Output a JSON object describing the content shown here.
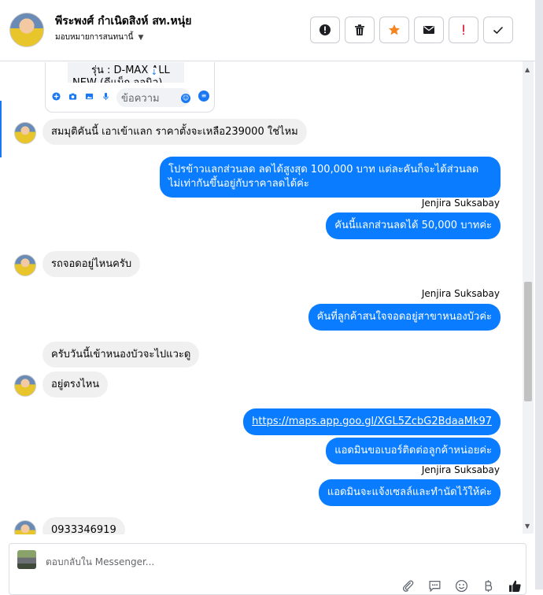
{
  "header": {
    "contact_name": "พีระพงศ์ กำเนิดสิงห์ สท.หนุ่ย",
    "assign_label": "มอบหมายการสนทนานี้",
    "actions": [
      {
        "name": "report-button",
        "icon": "exclamation-circle-icon"
      },
      {
        "name": "delete-button",
        "icon": "trash-icon"
      },
      {
        "name": "star-button",
        "icon": "star-icon"
      },
      {
        "name": "mark-unread-button",
        "icon": "envelope-icon"
      },
      {
        "name": "spam-button",
        "icon": "exclamation-icon"
      },
      {
        "name": "done-button",
        "icon": "check-icon"
      }
    ]
  },
  "widget": {
    "line1": "รุ่น : D-MAX ALL",
    "line2": "NEW (ดีแม็ก ออนิว)",
    "input_placeholder": "ข้อความ"
  },
  "messages": {
    "m1": "สมมุติคันนี้ เอาเข้าแลก ราคาตั้งจะเหลือ239000 ใช่ไหม",
    "m2_line1": "โปรข้าวแลกส่วนลด ลดได้สูงสุด 100,000 บาท แต่ละคันก็จะได้ส่วนลด",
    "m2_line2": "ไม่เท่ากันขึ้นอยู่กับราคาลดได้ค่ะ",
    "sender1": "Jenjira Suksabay",
    "m3": "คันนี้แลกส่วนลดได้ 50,000 บาทค่ะ",
    "m4": "รถจอดอยู่ไหนครับ",
    "sender2": "Jenjira Suksabay",
    "m5": "คันที่ลูกค้าสนใจจอดอยู่สาขาหนองบัวค่ะ",
    "m6": "ครับวันนี้เข้าหนองบัวจะไปแวะดู",
    "m7": "อยู่ตรงไหน",
    "m8": "https://maps.app.goo.gl/XGL5ZcbG2BdaaMk97",
    "m9": "แอดมินขอเบอร์ติดต่อลูกค้าหน่อยค่ะ",
    "sender3": "Jenjira Suksabay",
    "m10": "แอดมินจะแจ้งเซลล์และทำนัดไว้ให้ค่ะ",
    "m11": "0933346919"
  },
  "composer": {
    "placeholder": "ตอบกลับใน Messenger..."
  },
  "colors": {
    "outgoing": "#0a7cff",
    "incoming": "#f0f0f0",
    "accent": "#1877f2"
  }
}
